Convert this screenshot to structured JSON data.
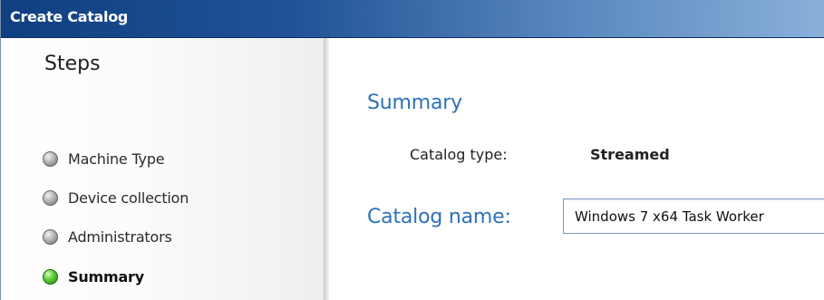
{
  "window": {
    "title": "Create Catalog"
  },
  "sidebar": {
    "heading": "Steps",
    "items": [
      {
        "label": "Machine Type",
        "state": "inactive"
      },
      {
        "label": "Device collection",
        "state": "inactive"
      },
      {
        "label": "Administrators",
        "state": "inactive"
      },
      {
        "label": "Summary",
        "state": "active"
      }
    ]
  },
  "main": {
    "section_title": "Summary",
    "catalog_type": {
      "label": "Catalog type:",
      "value": "Streamed"
    },
    "catalog_name": {
      "label": "Catalog name:",
      "value": "Windows 7 x64 Task Worker"
    }
  },
  "colors": {
    "title_bar": "#1f5396",
    "accent_blue": "#2e71b8",
    "active_step": "#3fbf23",
    "inactive_step": "#8a8a8a"
  },
  "icons": {
    "step_inactive": "gray-circle-icon",
    "step_active": "green-circle-icon"
  }
}
